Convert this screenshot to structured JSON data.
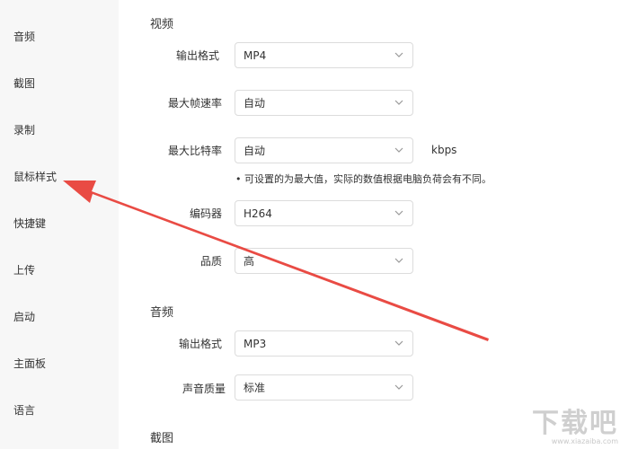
{
  "sidebar": {
    "items": [
      {
        "label": "音频"
      },
      {
        "label": "截图"
      },
      {
        "label": "录制"
      },
      {
        "label": "鼠标样式"
      },
      {
        "label": "快捷键"
      },
      {
        "label": "上传"
      },
      {
        "label": "启动"
      },
      {
        "label": "主面板"
      },
      {
        "label": "语言"
      }
    ]
  },
  "video": {
    "title": "视频",
    "output_format": {
      "label": "输出格式",
      "value": "MP4"
    },
    "max_fps": {
      "label": "最大帧速率",
      "value": "自动"
    },
    "max_bitrate": {
      "label": "最大比特率",
      "value": "自动",
      "unit": "kbps"
    },
    "note": "• 可设置的为最大值，实际的数值根据电脑负荷会有不同。",
    "encoder": {
      "label": "编码器",
      "value": "H264"
    },
    "quality": {
      "label": "品质",
      "value": "高"
    }
  },
  "audio": {
    "title": "音频",
    "output_format": {
      "label": "输出格式",
      "value": "MP3"
    },
    "sound_quality": {
      "label": "声音质量",
      "value": "标准"
    }
  },
  "screenshot": {
    "title": "截图"
  },
  "annotation": {
    "arrow_color": "#e8413a"
  },
  "watermark": {
    "main": "下载吧",
    "url": "www.xiazaiba.com"
  }
}
